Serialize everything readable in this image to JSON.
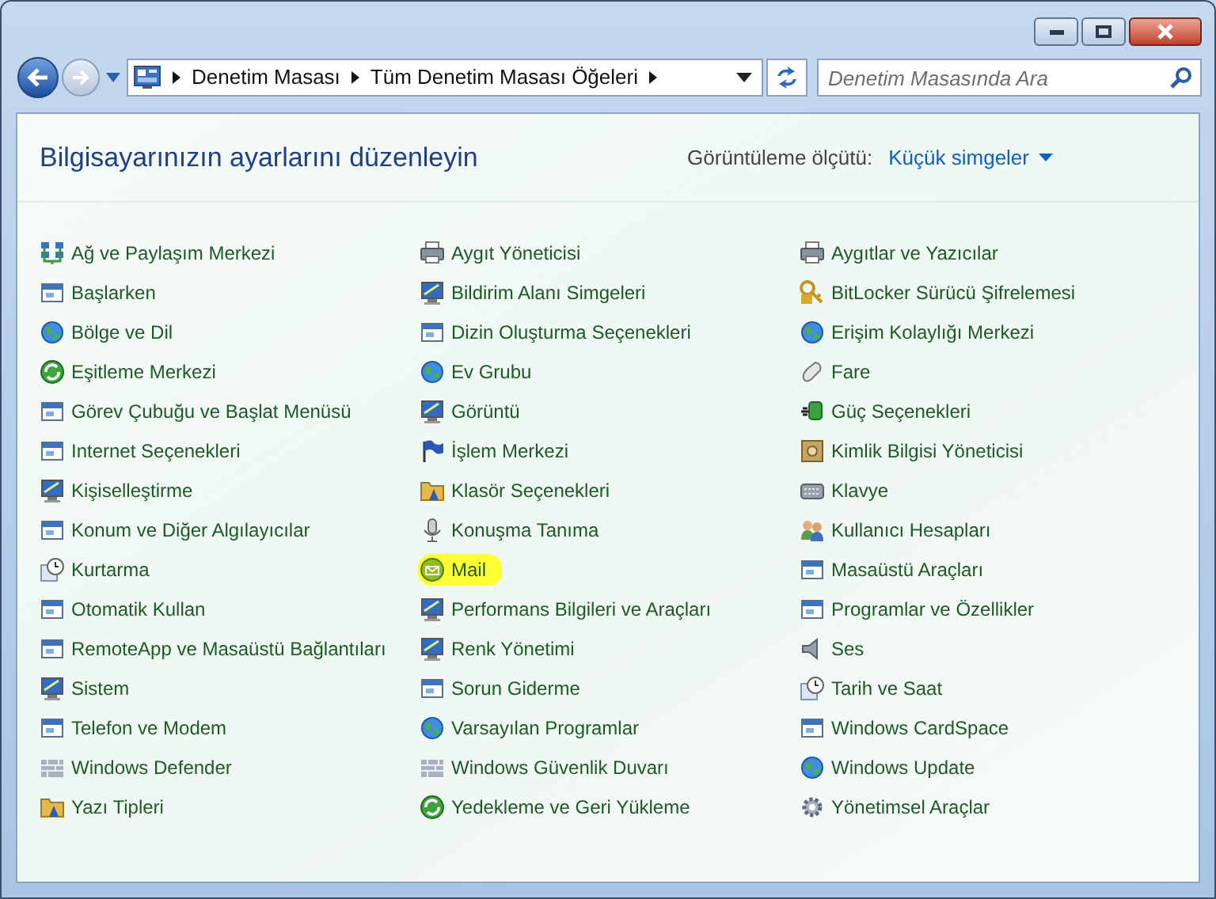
{
  "address_bar": {
    "breadcrumbs": [
      "Denetim Masası",
      "Tüm Denetim Masası Öğeleri"
    ]
  },
  "search": {
    "placeholder": "Denetim Masasında Ara"
  },
  "heading": "Bilgisayarınızın ayarlarını düzenleyin",
  "view_by": {
    "label": "Görüntüleme ölçütü:",
    "value": "Küçük simgeler"
  },
  "columns": [
    {
      "items": [
        {
          "label": "Ağ ve Paylaşım Merkezi",
          "highlighted": false
        },
        {
          "label": "Başlarken",
          "highlighted": false
        },
        {
          "label": "Bölge ve Dil",
          "highlighted": false
        },
        {
          "label": "Eşitleme Merkezi",
          "highlighted": false
        },
        {
          "label": "Görev Çubuğu ve Başlat Menüsü",
          "highlighted": false
        },
        {
          "label": "Internet Seçenekleri",
          "highlighted": false
        },
        {
          "label": "Kişiselleştirme",
          "highlighted": false
        },
        {
          "label": "Konum ve Diğer Algılayıcılar",
          "highlighted": false
        },
        {
          "label": "Kurtarma",
          "highlighted": false
        },
        {
          "label": "Otomatik Kullan",
          "highlighted": false
        },
        {
          "label": "RemoteApp ve Masaüstü Bağlantıları",
          "highlighted": false
        },
        {
          "label": "Sistem",
          "highlighted": false
        },
        {
          "label": "Telefon ve Modem",
          "highlighted": false
        },
        {
          "label": "Windows Defender",
          "highlighted": false
        },
        {
          "label": "Yazı Tipleri",
          "highlighted": false
        }
      ]
    },
    {
      "items": [
        {
          "label": "Aygıt Yöneticisi",
          "highlighted": false
        },
        {
          "label": "Bildirim Alanı Simgeleri",
          "highlighted": false
        },
        {
          "label": "Dizin Oluşturma Seçenekleri",
          "highlighted": false
        },
        {
          "label": "Ev Grubu",
          "highlighted": false
        },
        {
          "label": "Görüntü",
          "highlighted": false
        },
        {
          "label": "İşlem Merkezi",
          "highlighted": false
        },
        {
          "label": "Klasör Seçenekleri",
          "highlighted": false
        },
        {
          "label": "Konuşma Tanıma",
          "highlighted": false
        },
        {
          "label": "Mail",
          "highlighted": true
        },
        {
          "label": "Performans Bilgileri ve Araçları",
          "highlighted": false
        },
        {
          "label": "Renk Yönetimi",
          "highlighted": false
        },
        {
          "label": "Sorun Giderme",
          "highlighted": false
        },
        {
          "label": "Varsayılan Programlar",
          "highlighted": false
        },
        {
          "label": "Windows Güvenlik Duvarı",
          "highlighted": false
        },
        {
          "label": "Yedekleme ve Geri Yükleme",
          "highlighted": false
        }
      ]
    },
    {
      "items": [
        {
          "label": "Aygıtlar ve Yazıcılar",
          "highlighted": false
        },
        {
          "label": "BitLocker Sürücü Şifrelemesi",
          "highlighted": false
        },
        {
          "label": "Erişim Kolaylığı Merkezi",
          "highlighted": false
        },
        {
          "label": "Fare",
          "highlighted": false
        },
        {
          "label": "Güç Seçenekleri",
          "highlighted": false
        },
        {
          "label": "Kimlik Bilgisi Yöneticisi",
          "highlighted": false
        },
        {
          "label": "Klavye",
          "highlighted": false
        },
        {
          "label": "Kullanıcı Hesapları",
          "highlighted": false
        },
        {
          "label": "Masaüstü Araçları",
          "highlighted": false
        },
        {
          "label": "Programlar ve Özellikler",
          "highlighted": false
        },
        {
          "label": "Ses",
          "highlighted": false
        },
        {
          "label": "Tarih ve Saat",
          "highlighted": false
        },
        {
          "label": "Windows CardSpace",
          "highlighted": false
        },
        {
          "label": "Windows Update",
          "highlighted": false
        },
        {
          "label": "Yönetimsel Araçlar",
          "highlighted": false
        }
      ]
    }
  ]
}
